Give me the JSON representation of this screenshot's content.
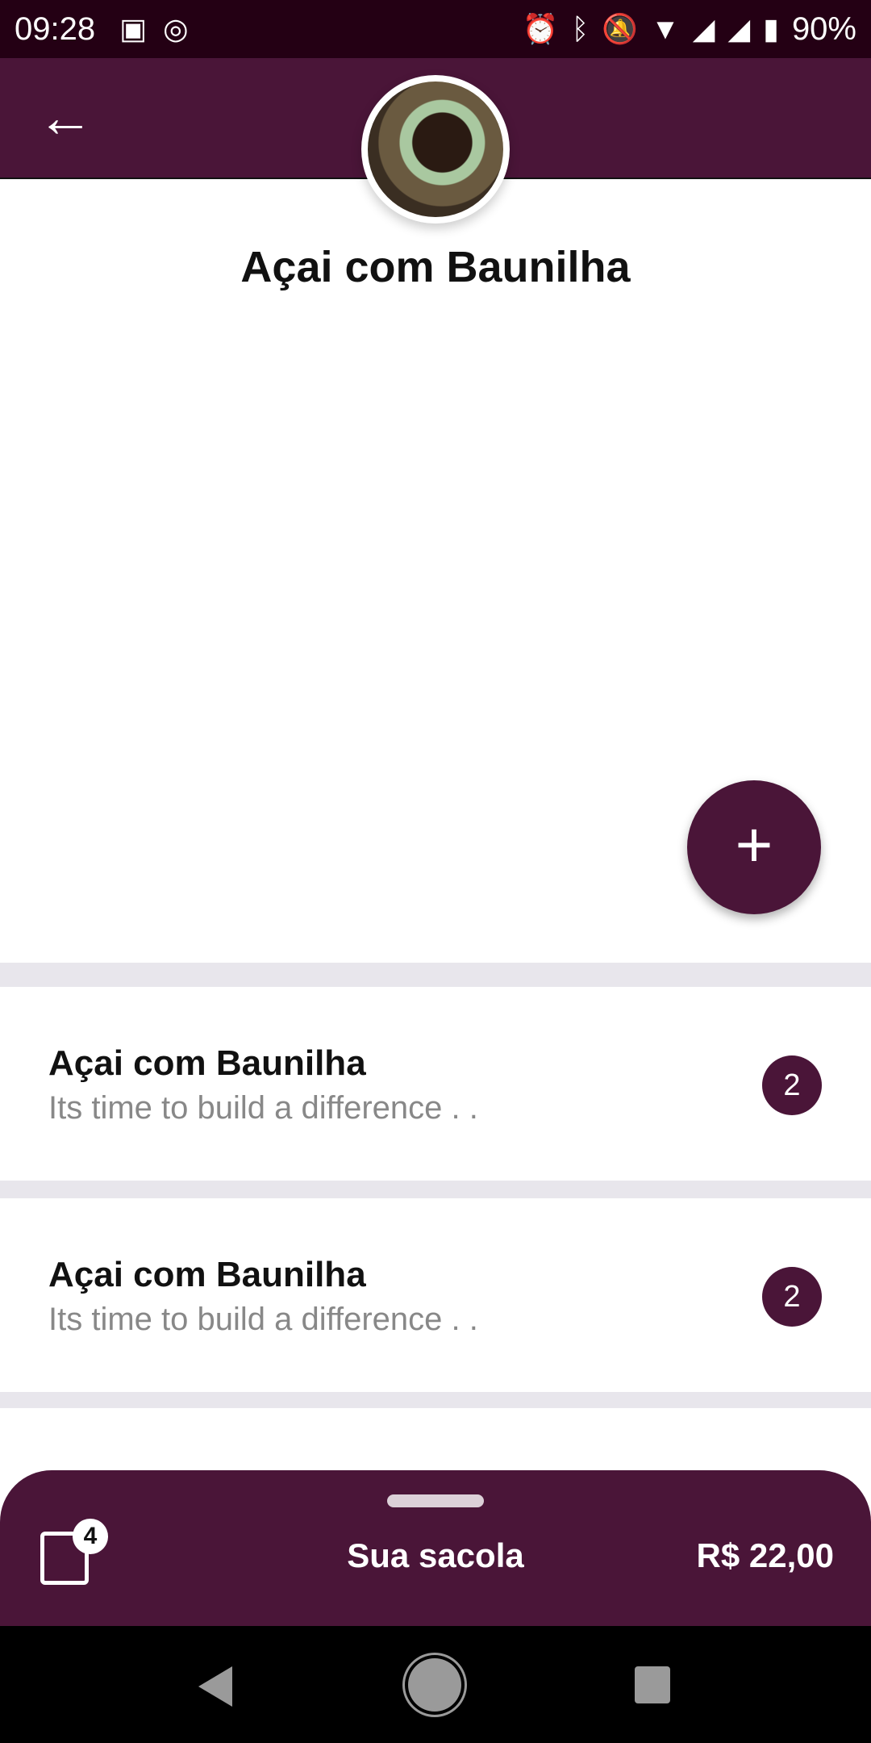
{
  "status_bar": {
    "time": "09:28",
    "battery": "90%"
  },
  "header": {
    "back_icon": "arrow-left-icon"
  },
  "product": {
    "title": "Açai com Baunilha"
  },
  "fab": {
    "label": "+"
  },
  "items": [
    {
      "title": "Açai com Baunilha",
      "subtitle": "Its time to build a difference . .",
      "count": "2"
    },
    {
      "title": "Açai com Baunilha",
      "subtitle": "Its time to build a difference . .",
      "count": "2"
    }
  ],
  "bag": {
    "count": "4",
    "label": "Sua sacola",
    "total": "R$ 22,00"
  },
  "colors": {
    "primary": "#4a1538",
    "status": "#240014"
  }
}
